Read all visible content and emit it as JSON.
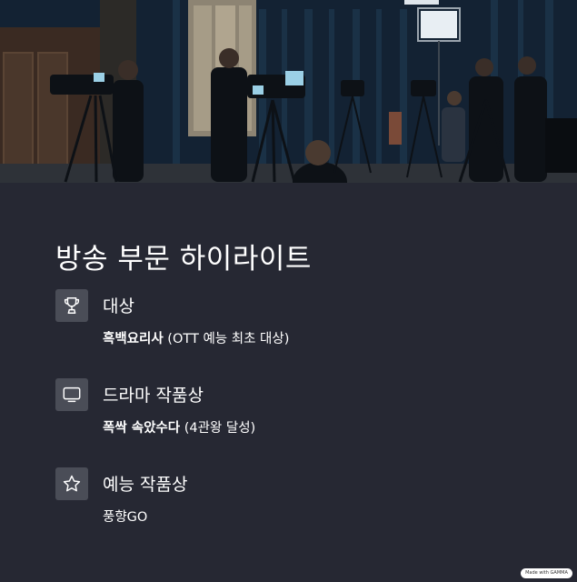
{
  "hero": {
    "image_subject": "tv-studio-cameras-photo"
  },
  "section": {
    "title": "방송 부문 하이라이트"
  },
  "awards": [
    {
      "icon": "trophy-icon",
      "heading": "대상",
      "detail_bold": "흑백요리사",
      "detail_rest": " (OTT 예능 최초 대상)"
    },
    {
      "icon": "tv-icon",
      "heading": "드라마 작품상",
      "detail_bold": "폭싹 속았수다",
      "detail_rest": " (4관왕 달성)"
    },
    {
      "icon": "star-icon",
      "heading": "예능 작품상",
      "detail_bold": "",
      "detail_rest": "풍향GO"
    }
  ],
  "badge": {
    "label": "Made with GAMMA"
  },
  "colors": {
    "background": "#262833",
    "icon_tile": "#4a4d57",
    "text": "#ffffff"
  }
}
